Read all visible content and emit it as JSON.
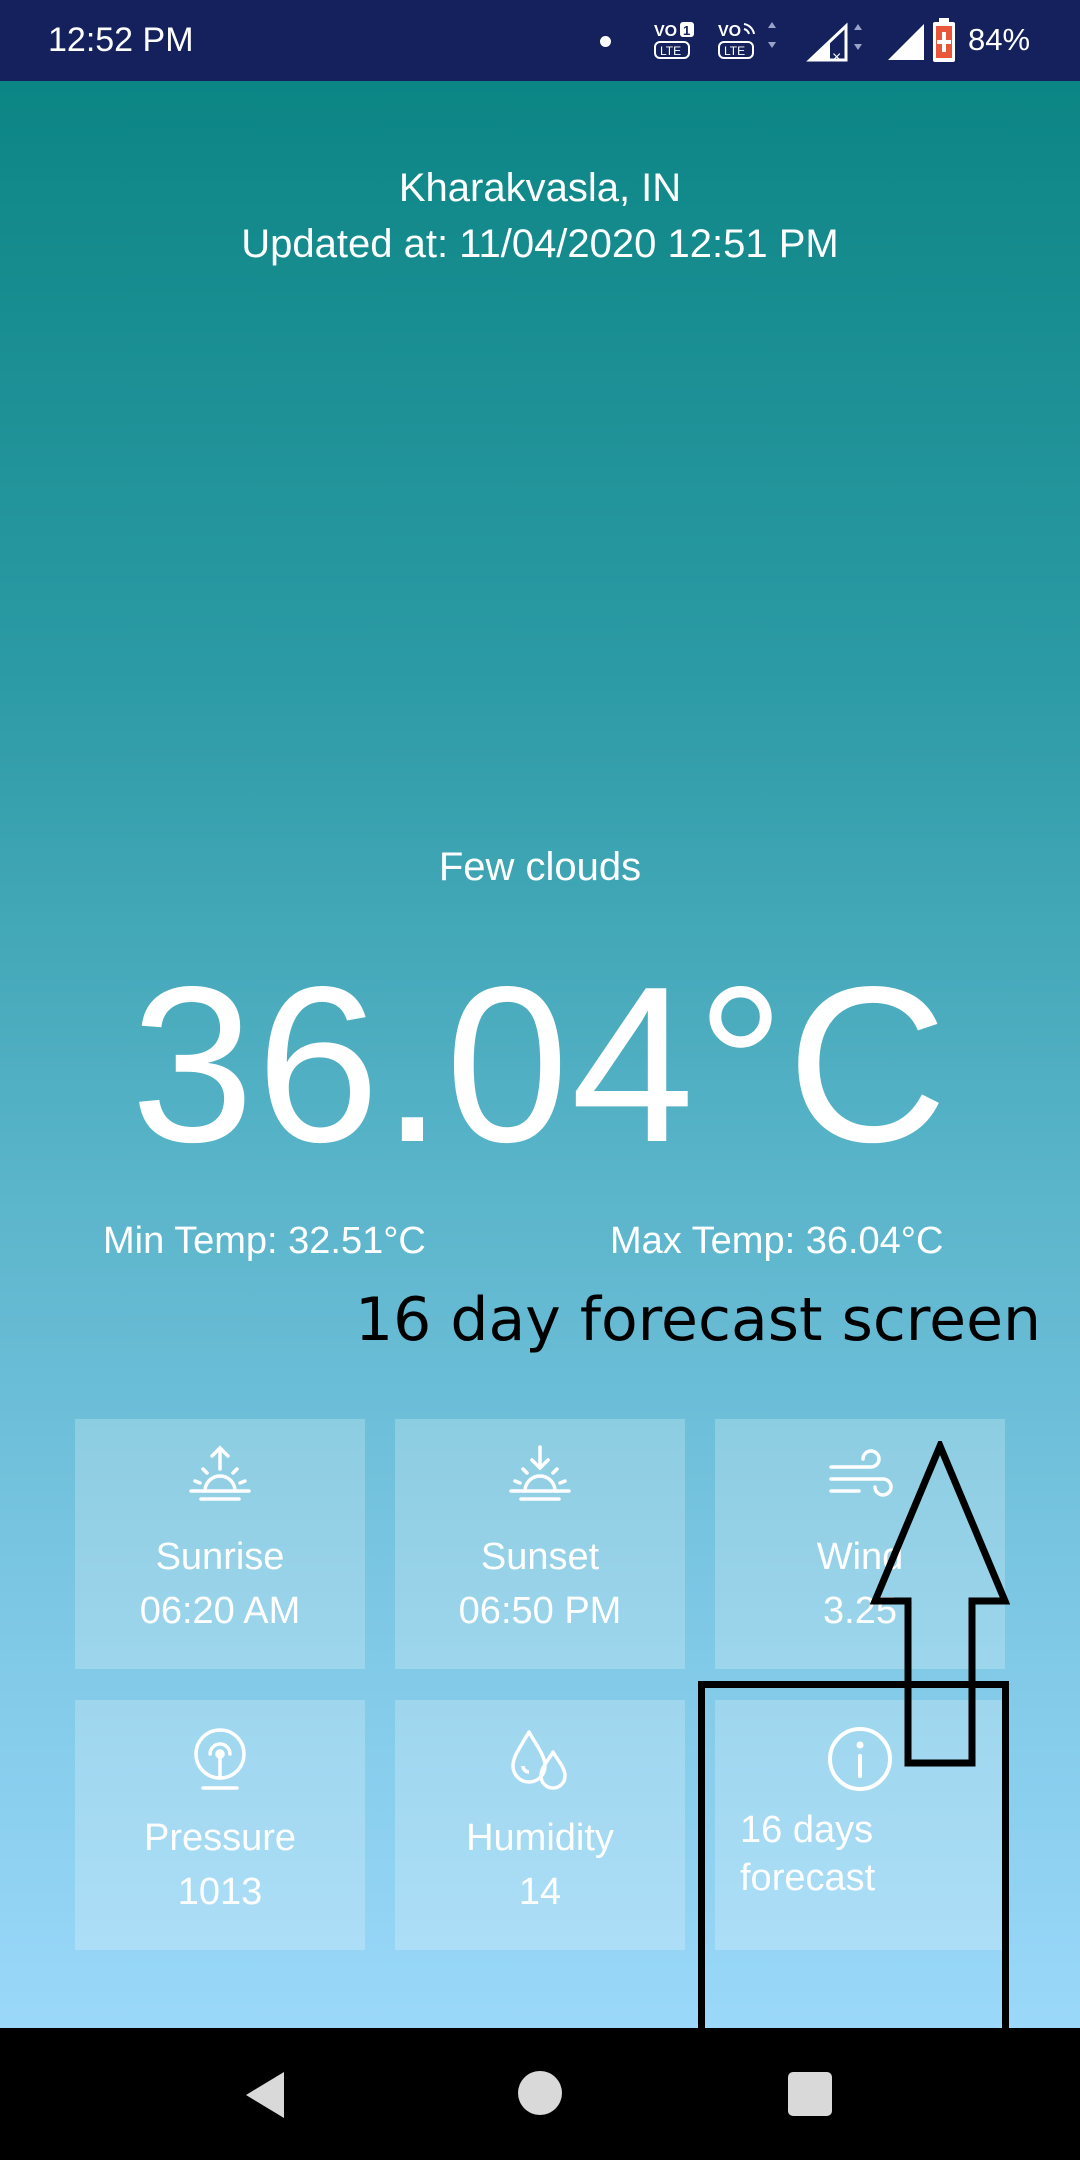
{
  "status_bar": {
    "time": "12:52 PM",
    "battery_percent": "84%",
    "icons": [
      "notification-dot-icon",
      "volte-1-icon",
      "volte-wifi-icon",
      "signal-no-service-icon",
      "signal-full-icon",
      "battery-charging-icon"
    ],
    "background_color": "#14215c"
  },
  "weather": {
    "location": "Kharakvasla, IN",
    "updated_at": "Updated at: 11/04/2020 12:51 PM",
    "condition": "Few clouds",
    "temperature": "36.04°C",
    "min_temp": "Min Temp: 32.51°C",
    "max_temp": "Max Temp: 36.04°C"
  },
  "annotation": {
    "text": "16 day forecast screen",
    "arrow_direction": "up",
    "color": "#000000"
  },
  "tiles": [
    {
      "label": "Sunrise",
      "value": "06:20 AM",
      "icon": "sunrise-icon"
    },
    {
      "label": "Sunset",
      "value": "06:50 PM",
      "icon": "sunset-icon"
    },
    {
      "label": "Wind",
      "value": "3.25",
      "icon": "wind-icon"
    },
    {
      "label": "Pressure",
      "value": "1013",
      "icon": "pressure-gauge-icon"
    },
    {
      "label": "Humidity",
      "value": "14",
      "icon": "humidity-drops-icon"
    },
    {
      "label": "16 days forecast",
      "icon": "info-icon"
    }
  ],
  "nav_bar": {
    "buttons": [
      "back-icon",
      "home-icon",
      "recents-icon"
    ]
  },
  "colors": {
    "gradient_top": "#0c8585",
    "gradient_bottom": "#9bd8fa",
    "text": "#ffffff"
  }
}
